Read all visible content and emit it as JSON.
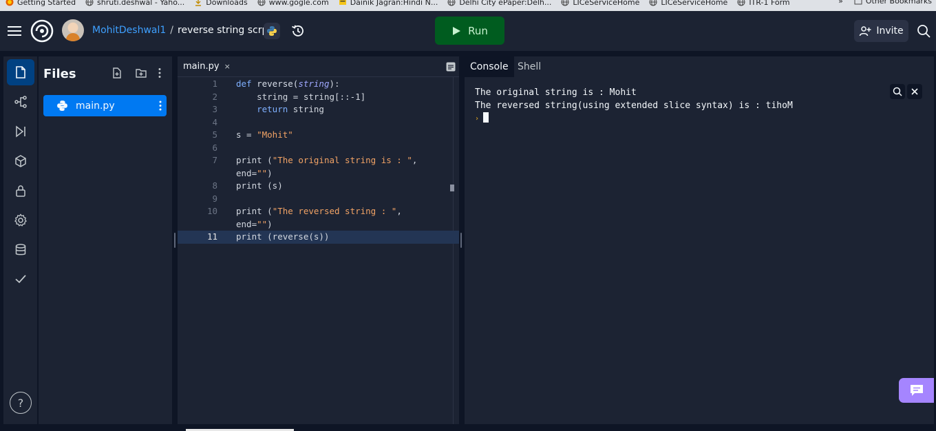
{
  "bookmarks": [
    {
      "label": "Getting Started",
      "icon": "firefox-icon"
    },
    {
      "label": "shruti.deshwal - Yaho...",
      "icon": "globe-icon"
    },
    {
      "label": "Downloads",
      "icon": "download-icon"
    },
    {
      "label": "www.gogle.com",
      "icon": "globe-icon"
    },
    {
      "label": "Dainik Jagran:Hindi N...",
      "icon": "news-icon"
    },
    {
      "label": "Delhi City ePaper:Delh...",
      "icon": "globe-icon"
    },
    {
      "label": "LICeServiceHome",
      "icon": "globe-icon"
    },
    {
      "label": "LICeServiceHome",
      "icon": "globe-icon"
    },
    {
      "label": "ITR-1 Form",
      "icon": "globe-icon"
    }
  ],
  "bookmarks_other": "Other Bookmarks",
  "header": {
    "user": "MohitDeshwal1",
    "separator": "/",
    "repl_name": "reverse string scrpt",
    "run_label": "Run",
    "invite_label": "Invite"
  },
  "files": {
    "title": "Files",
    "items": [
      {
        "name": "main.py"
      }
    ]
  },
  "editor": {
    "tab": "main.py",
    "tab_close": "×",
    "lines": [
      {
        "num": "1",
        "tokens": [
          [
            "kw",
            "def "
          ],
          [
            "fn",
            "reverse("
          ],
          [
            "param",
            "string"
          ],
          [
            "plain",
            "):"
          ]
        ]
      },
      {
        "num": "2",
        "tokens": [
          [
            "plain",
            "    string = string[::-1]"
          ]
        ]
      },
      {
        "num": "3",
        "tokens": [
          [
            "kw",
            "    return "
          ],
          [
            "plain",
            "string"
          ]
        ]
      },
      {
        "num": "4",
        "tokens": []
      },
      {
        "num": "5",
        "tokens": [
          [
            "plain",
            "s = "
          ],
          [
            "str",
            "\"Mohit\""
          ]
        ]
      },
      {
        "num": "6",
        "tokens": []
      },
      {
        "num": "7",
        "tokens": [
          [
            "plain",
            "print ("
          ],
          [
            "str",
            "\"The original string is : \""
          ],
          [
            "plain",
            ","
          ]
        ]
      },
      {
        "num": "",
        "tokens": [
          [
            "plain",
            "end="
          ],
          [
            "str",
            "\"\""
          ],
          [
            "plain",
            ")"
          ]
        ]
      },
      {
        "num": "8",
        "tokens": [
          [
            "plain",
            "print (s)"
          ]
        ]
      },
      {
        "num": "9",
        "tokens": []
      },
      {
        "num": "10",
        "tokens": [
          [
            "plain",
            "print ("
          ],
          [
            "str",
            "\"The reversed string : \""
          ],
          [
            "plain",
            ","
          ]
        ]
      },
      {
        "num": "",
        "tokens": [
          [
            "plain",
            "end="
          ],
          [
            "str",
            "\"\""
          ],
          [
            "plain",
            ")"
          ]
        ]
      },
      {
        "num": "11",
        "active": true,
        "tokens": [
          [
            "plain",
            "print (reverse(s))"
          ]
        ]
      }
    ]
  },
  "console": {
    "tabs": [
      "Console",
      "Shell"
    ],
    "output": [
      "The original string is : Mohit",
      "The reversed string(using extended slice syntax) is : tihoM"
    ],
    "prompt": "›"
  },
  "help_label": "?",
  "colors": {
    "accent": "#0079f2",
    "run": "#005c1f",
    "chat": "#a585ff"
  }
}
